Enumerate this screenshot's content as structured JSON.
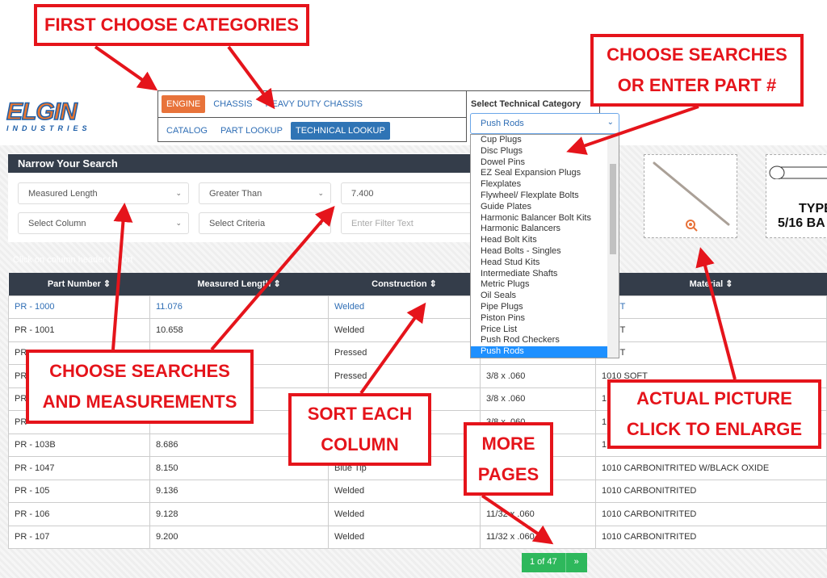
{
  "logo": {
    "name": "ELGIN",
    "sub": "INDUSTRIES"
  },
  "nav": {
    "row1": [
      "ENGINE",
      "CHASSIS",
      "HEAVY DUTY CHASSIS"
    ],
    "row2": [
      "CATALOG",
      "PART LOOKUP",
      "TECHNICAL LOOKUP"
    ],
    "active_row1": "ENGINE",
    "active_row2": "TECHNICAL LOOKUP"
  },
  "category": {
    "label": "Select Technical Category",
    "selected": "Push Rods",
    "options": [
      "Cup Plugs",
      "Disc Plugs",
      "Dowel Pins",
      "EZ Seal Expansion Plugs",
      "Flexplates",
      "Flywheel/ Flexplate Bolts",
      "Guide Plates",
      "Harmonic Balancer Bolt Kits",
      "Harmonic Balancers",
      "Head Bolt Kits",
      "Head Bolts - Singles",
      "Head Stud Kits",
      "Intermediate Shafts",
      "Metric Plugs",
      "Oil Seals",
      "Pipe Plugs",
      "Piston Pins",
      "Price List",
      "Push Rod Checkers",
      "Push Rods"
    ]
  },
  "search": {
    "title": "Narrow Your Search",
    "filter1": {
      "column": "Measured Length",
      "criteria": "Greater Than",
      "value": "7.400"
    },
    "filter2": {
      "column": "Select Column",
      "criteria": "Select Criteria",
      "placeholder": "Enter Filter Text"
    },
    "hint": "Click on column header to sort"
  },
  "table": {
    "headers": [
      "Part Number",
      "Measured Length",
      "Construction",
      "",
      "Material"
    ],
    "rows": [
      [
        "PR - 1000",
        "11.076",
        "Welded",
        "",
        "SOFT"
      ],
      [
        "PR - 1001",
        "10.658",
        "Welded",
        "",
        "SOFT"
      ],
      [
        "PR",
        "",
        "Pressed",
        "",
        "SOFT"
      ],
      [
        "PR",
        "",
        "Pressed",
        "3/8 x .060",
        "1010 SOFT"
      ],
      [
        "PR",
        "",
        "",
        "3/8 x .060",
        "1"
      ],
      [
        "PR",
        "",
        "",
        "3/8 x .060",
        "1"
      ],
      [
        "PR - 103B",
        "8.686",
        "",
        "",
        "1"
      ],
      [
        "PR - 1047",
        "8.150",
        "Blue Tip",
        "",
        "1010 CARBONITRITED W/BLACK OXIDE"
      ],
      [
        "PR - 105",
        "9.136",
        "Welded",
        "",
        "1010 CARBONITRITED"
      ],
      [
        "PR - 106",
        "9.128",
        "Welded",
        "11/32 x .060",
        "1010 CARBONITRITED"
      ],
      [
        "PR - 107",
        "9.200",
        "Welded",
        "11/32 x .060",
        "1010 CARBONITRITED"
      ]
    ]
  },
  "pager": {
    "label": "1 of 47",
    "next": "»"
  },
  "images": {
    "second_text1": "TYPE",
    "second_text2": "5/16 BA"
  },
  "annotations": {
    "a1": "FIRST CHOOSE CATEGORIES",
    "a2": [
      "CHOOSE SEARCHES",
      "OR ENTER PART #"
    ],
    "a3": [
      "CHOOSE SEARCHES",
      "AND MEASUREMENTS"
    ],
    "a4": [
      "SORT EACH",
      "COLUMN"
    ],
    "a5": [
      "MORE",
      "PAGES"
    ],
    "a6": [
      "ACTUAL PICTURE",
      "CLICK TO ENLARGE"
    ]
  },
  "colors": {
    "accent": "#e8733a",
    "primary": "#2f74b5",
    "header": "#343d4a",
    "pager": "#2eb85c",
    "annotation": "#e5141b"
  }
}
